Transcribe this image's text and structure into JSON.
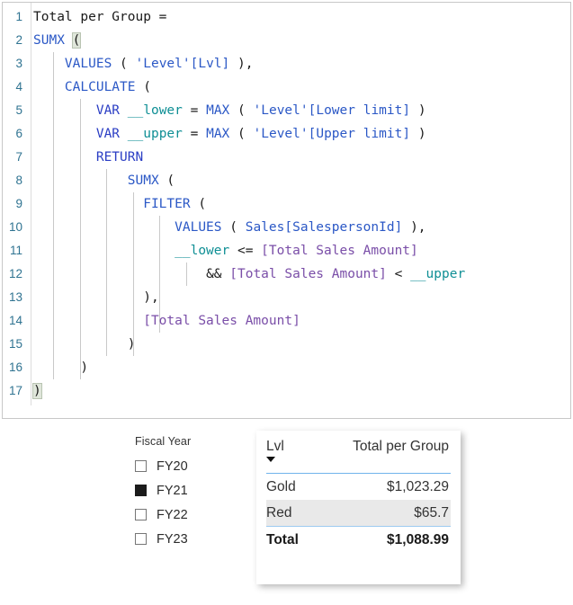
{
  "editor": {
    "name": "dax-formula-editor",
    "language": "DAX",
    "lines": [
      {
        "number": "1",
        "indent_guides": 0,
        "tokens": [
          {
            "text": "Total per Group =",
            "type": "plain"
          }
        ]
      },
      {
        "number": "2",
        "indent_guides": 0,
        "tokens": [
          {
            "text": "SUMX",
            "type": "fn"
          },
          {
            "text": " ",
            "type": "plain"
          },
          {
            "text": "(",
            "type": "bracket-highlight"
          }
        ]
      },
      {
        "number": "3",
        "indent_guides": 1,
        "tokens": [
          {
            "text": "    ",
            "type": "plain"
          },
          {
            "text": "VALUES",
            "type": "fn"
          },
          {
            "text": " ( ",
            "type": "plain"
          },
          {
            "text": "'Level'[Lvl]",
            "type": "ref"
          },
          {
            "text": " ),",
            "type": "plain"
          }
        ]
      },
      {
        "number": "4",
        "indent_guides": 1,
        "tokens": [
          {
            "text": "    ",
            "type": "plain"
          },
          {
            "text": "CALCULATE",
            "type": "fn"
          },
          {
            "text": " (",
            "type": "plain"
          }
        ]
      },
      {
        "number": "5",
        "indent_guides": 2,
        "tokens": [
          {
            "text": "        ",
            "type": "plain"
          },
          {
            "text": "VAR",
            "type": "kw"
          },
          {
            "text": " ",
            "type": "plain"
          },
          {
            "text": "__lower",
            "type": "var"
          },
          {
            "text": " = ",
            "type": "plain"
          },
          {
            "text": "MAX",
            "type": "fn"
          },
          {
            "text": " ( ",
            "type": "plain"
          },
          {
            "text": "'Level'[Lower limit]",
            "type": "ref"
          },
          {
            "text": " )",
            "type": "plain"
          }
        ]
      },
      {
        "number": "6",
        "indent_guides": 2,
        "tokens": [
          {
            "text": "        ",
            "type": "plain"
          },
          {
            "text": "VAR",
            "type": "kw"
          },
          {
            "text": " ",
            "type": "plain"
          },
          {
            "text": "__upper",
            "type": "var"
          },
          {
            "text": " = ",
            "type": "plain"
          },
          {
            "text": "MAX",
            "type": "fn"
          },
          {
            "text": " ( ",
            "type": "plain"
          },
          {
            "text": "'Level'[Upper limit]",
            "type": "ref"
          },
          {
            "text": " )",
            "type": "plain"
          }
        ]
      },
      {
        "number": "7",
        "indent_guides": 2,
        "tokens": [
          {
            "text": "        ",
            "type": "plain"
          },
          {
            "text": "RETURN",
            "type": "kw"
          }
        ]
      },
      {
        "number": "8",
        "indent_guides": 3,
        "tokens": [
          {
            "text": "            ",
            "type": "plain"
          },
          {
            "text": "SUMX",
            "type": "fn"
          },
          {
            "text": " (",
            "type": "plain"
          }
        ]
      },
      {
        "number": "9",
        "indent_guides": 4,
        "tokens": [
          {
            "text": "              ",
            "type": "plain"
          },
          {
            "text": "FILTER",
            "type": "fn"
          },
          {
            "text": " (",
            "type": "plain"
          }
        ]
      },
      {
        "number": "10",
        "indent_guides": 5,
        "tokens": [
          {
            "text": "                  ",
            "type": "plain"
          },
          {
            "text": "VALUES",
            "type": "fn"
          },
          {
            "text": " ( ",
            "type": "plain"
          },
          {
            "text": "Sales[SalespersonId]",
            "type": "ref"
          },
          {
            "text": " ),",
            "type": "plain"
          }
        ]
      },
      {
        "number": "11",
        "indent_guides": 5,
        "tokens": [
          {
            "text": "                  ",
            "type": "plain"
          },
          {
            "text": "__lower",
            "type": "var"
          },
          {
            "text": " <= ",
            "type": "plain"
          },
          {
            "text": "[Total Sales Amount]",
            "type": "meas"
          }
        ]
      },
      {
        "number": "12",
        "indent_guides": 6,
        "tokens": [
          {
            "text": "                      ",
            "type": "plain"
          },
          {
            "text": "&& ",
            "type": "plain"
          },
          {
            "text": "[Total Sales Amount]",
            "type": "meas"
          },
          {
            "text": " < ",
            "type": "plain"
          },
          {
            "text": "__upper",
            "type": "var"
          }
        ]
      },
      {
        "number": "13",
        "indent_guides": 5,
        "tokens": [
          {
            "text": "              ",
            "type": "plain"
          },
          {
            "text": "),",
            "type": "plain"
          }
        ]
      },
      {
        "number": "14",
        "indent_guides": 5,
        "tokens": [
          {
            "text": "              ",
            "type": "plain"
          },
          {
            "text": "[Total Sales Amount]",
            "type": "meas"
          }
        ]
      },
      {
        "number": "15",
        "indent_guides": 4,
        "tokens": [
          {
            "text": "            ",
            "type": "plain"
          },
          {
            "text": ")",
            "type": "plain"
          }
        ]
      },
      {
        "number": "16",
        "indent_guides": 2,
        "tokens": [
          {
            "text": "      ",
            "type": "plain"
          },
          {
            "text": ")",
            "type": "plain"
          }
        ]
      },
      {
        "number": "17",
        "indent_guides": 0,
        "tokens": [
          {
            "text": ")",
            "type": "bracket-highlight"
          }
        ]
      }
    ]
  },
  "slicer": {
    "name": "fiscal-year-slicer",
    "title": "Fiscal Year",
    "items": [
      {
        "label": "FY20",
        "checked": false
      },
      {
        "label": "FY21",
        "checked": true
      },
      {
        "label": "FY22",
        "checked": false
      },
      {
        "label": "FY23",
        "checked": false
      }
    ]
  },
  "table_visual": {
    "name": "total-per-group-table",
    "columns": [
      "Lvl",
      "Total per Group"
    ],
    "sort_column": "Lvl",
    "sort_direction": "descending",
    "rows": [
      {
        "lvl": "Gold",
        "value": "$1,023.29",
        "selected": false
      },
      {
        "lvl": "Red",
        "value": "$65.7",
        "selected": true
      }
    ],
    "total_row": {
      "lvl": "Total",
      "value": "$1,088.99"
    }
  },
  "colors": {
    "function": "#2b58c6",
    "reference": "#2b58c6",
    "variable": "#0f8f95",
    "keyword": "#2b3ec4",
    "measure": "#7a4ea8",
    "line_number": "#2f7391",
    "header_rule": "#70b4ec",
    "row_rule": "#9ecbf0",
    "selected_row": "#e9e9e9",
    "checkbox_checked": "#1b1b1b"
  }
}
